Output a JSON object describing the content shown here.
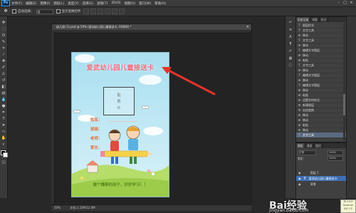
{
  "menubar": {
    "logo": "Ps",
    "items": [
      "文件(F)",
      "编辑(E)",
      "图像(I)",
      "图层(L)",
      "类型(Y)",
      "选择(S)",
      "滤镜(T)",
      "3D(D)",
      "视图(V)",
      "窗口(W)",
      "帮助(H)"
    ],
    "window_controls": [
      "–",
      "□",
      "×"
    ]
  },
  "options": {
    "tool_icon": "move-tool",
    "auto_select_label": "自动选择：",
    "auto_select_value": "组",
    "transform_label": "显示变换控件"
  },
  "document": {
    "tab_title": "幼儿园 (1).psd @ 50% (爱动幼儿园儿童接送卡, RGB/8) *",
    "zoom": "50%",
    "status": "文档:2.32M/12.0M"
  },
  "artwork": {
    "title": "爱武幼儿园儿童接送卡",
    "photo_line1": "贴",
    "photo_line2": "照",
    "photo_line3": "片",
    "fields": [
      "姓名：",
      "班级：",
      "老师：",
      "家长："
    ],
    "bottom_text": "做个懂事的孩子，好好学习！！",
    "colors": {
      "sky": "#9fd8ea",
      "title": "#e96a7a",
      "field": "#e07038",
      "grass": "#b6dc6a"
    }
  },
  "history": {
    "tabs": [
      "历史记录",
      "调整",
      "样式"
    ],
    "rows": [
      {
        "icon": "T",
        "label": "图层样式"
      },
      {
        "icon": "T",
        "label": "文字工具"
      },
      {
        "icon": "✥",
        "label": "移动"
      },
      {
        "icon": "T",
        "label": "文字工具"
      },
      {
        "icon": "✥",
        "label": "移动"
      },
      {
        "icon": "T",
        "label": "编辑文字图层"
      },
      {
        "icon": "✥",
        "label": "移动"
      },
      {
        "icon": "✥",
        "label": "粘贴"
      },
      {
        "icon": "T",
        "label": "文字工具"
      },
      {
        "icon": "✥",
        "label": "移动"
      },
      {
        "icon": "T",
        "label": "编辑文字图层"
      },
      {
        "icon": "✥",
        "label": "移动"
      },
      {
        "icon": "T",
        "label": "编辑文字图层"
      },
      {
        "icon": "✥",
        "label": "移动"
      },
      {
        "icon": "✥",
        "label": "粘贴"
      },
      {
        "icon": "✥",
        "label": "设置字符样式"
      },
      {
        "icon": "✥",
        "label": "新建图层"
      },
      {
        "icon": "✥",
        "label": "自由变换"
      },
      {
        "icon": "✥",
        "label": "移动"
      },
      {
        "icon": "✥",
        "label": "移动"
      },
      {
        "icon": "✥",
        "label": "粘贴"
      },
      {
        "icon": "✥",
        "label": "移动"
      },
      {
        "icon": "T",
        "label": "文字工具"
      }
    ]
  },
  "layers": {
    "tabs": [
      "图层",
      "通道",
      "路径"
    ],
    "blend_mode": "正常",
    "opacity": "100%",
    "fill": "100%",
    "lock_label": "锁定：",
    "rows": [
      {
        "label": "图层 1"
      },
      {
        "label": "爱武幼儿园儿童接送卡"
      },
      {
        "label": "背景"
      }
    ]
  },
  "watermark": {
    "brand": "Bai经验",
    "url": "jingyan.baidu.com",
    "box_line1": "Ps  14.2",
    "box_line2": "Scanner",
    "box_line3": "84.1 S"
  }
}
